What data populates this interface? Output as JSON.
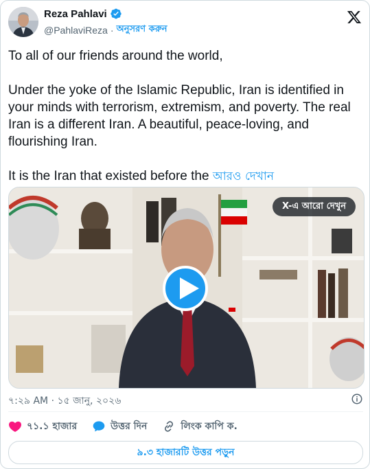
{
  "author": {
    "name": "Reza Pahlavi",
    "handle": "@PahlaviReza",
    "separator": "·",
    "follow_label": "অনুসরণ করুন",
    "verified": true
  },
  "post": {
    "paragraphs": [
      "To all of our friends around the world,",
      "Under the yoke of the Islamic Republic, Iran is identified in your minds with terrorism, extremism, and poverty. The real Iran is a different Iran. A beautiful, peace-loving, and flourishing Iran."
    ],
    "truncated_line": "It is the Iran that existed before the ",
    "show_more_label": "আরও দেখান"
  },
  "media": {
    "type": "video",
    "overlay_label": "X-এ আরো দেখুন",
    "play_icon": "play-icon"
  },
  "meta": {
    "time": "৭:২৯ AM",
    "separator": "·",
    "date": "১৫ জানু, ২০২৬"
  },
  "actions": {
    "like_count": "৭১.১ হাজার",
    "reply_label": "উত্তর দিন",
    "copy_link_label": "লিংক কাপি ক."
  },
  "replies_button_label": "৯.৩ হাজারটি উত্তর পড়ুন",
  "colors": {
    "accent": "#1d9bf0",
    "like": "#f91880",
    "text": "#0f1419",
    "secondary": "#536471"
  }
}
